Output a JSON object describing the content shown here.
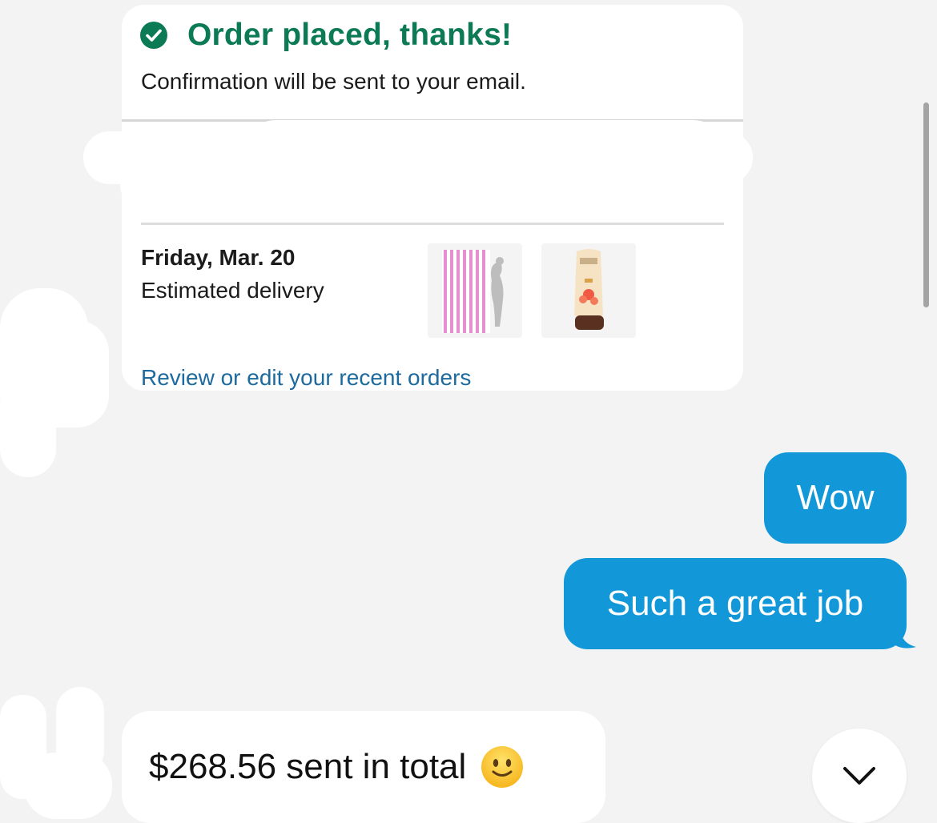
{
  "order_card": {
    "title": "Order placed, thanks!",
    "subtitle": "Confirmation will be sent to your email.",
    "delivery_date": "Friday, Mar. 20",
    "delivery_label": "Estimated delivery",
    "review_link": "Review or edit your recent orders",
    "products": [
      {
        "name": "pink-striped-towel"
      },
      {
        "name": "sunscreen-lotion"
      }
    ],
    "accent_color": "#0c7a55",
    "link_color": "#1d6a9e"
  },
  "messages": [
    {
      "direction": "outgoing",
      "text": "Wow"
    },
    {
      "direction": "outgoing",
      "text": "Such a great job"
    },
    {
      "direction": "incoming",
      "text": "$268.56 sent in total",
      "emoji": "slightly-smiling-face"
    }
  ],
  "colors": {
    "outgoing_bubble": "#1298d8",
    "incoming_bubble": "#ffffff",
    "background": "#f3f3f3"
  },
  "icons": {
    "check": "check-circle-icon",
    "scroll_down": "chevron-down-icon"
  }
}
